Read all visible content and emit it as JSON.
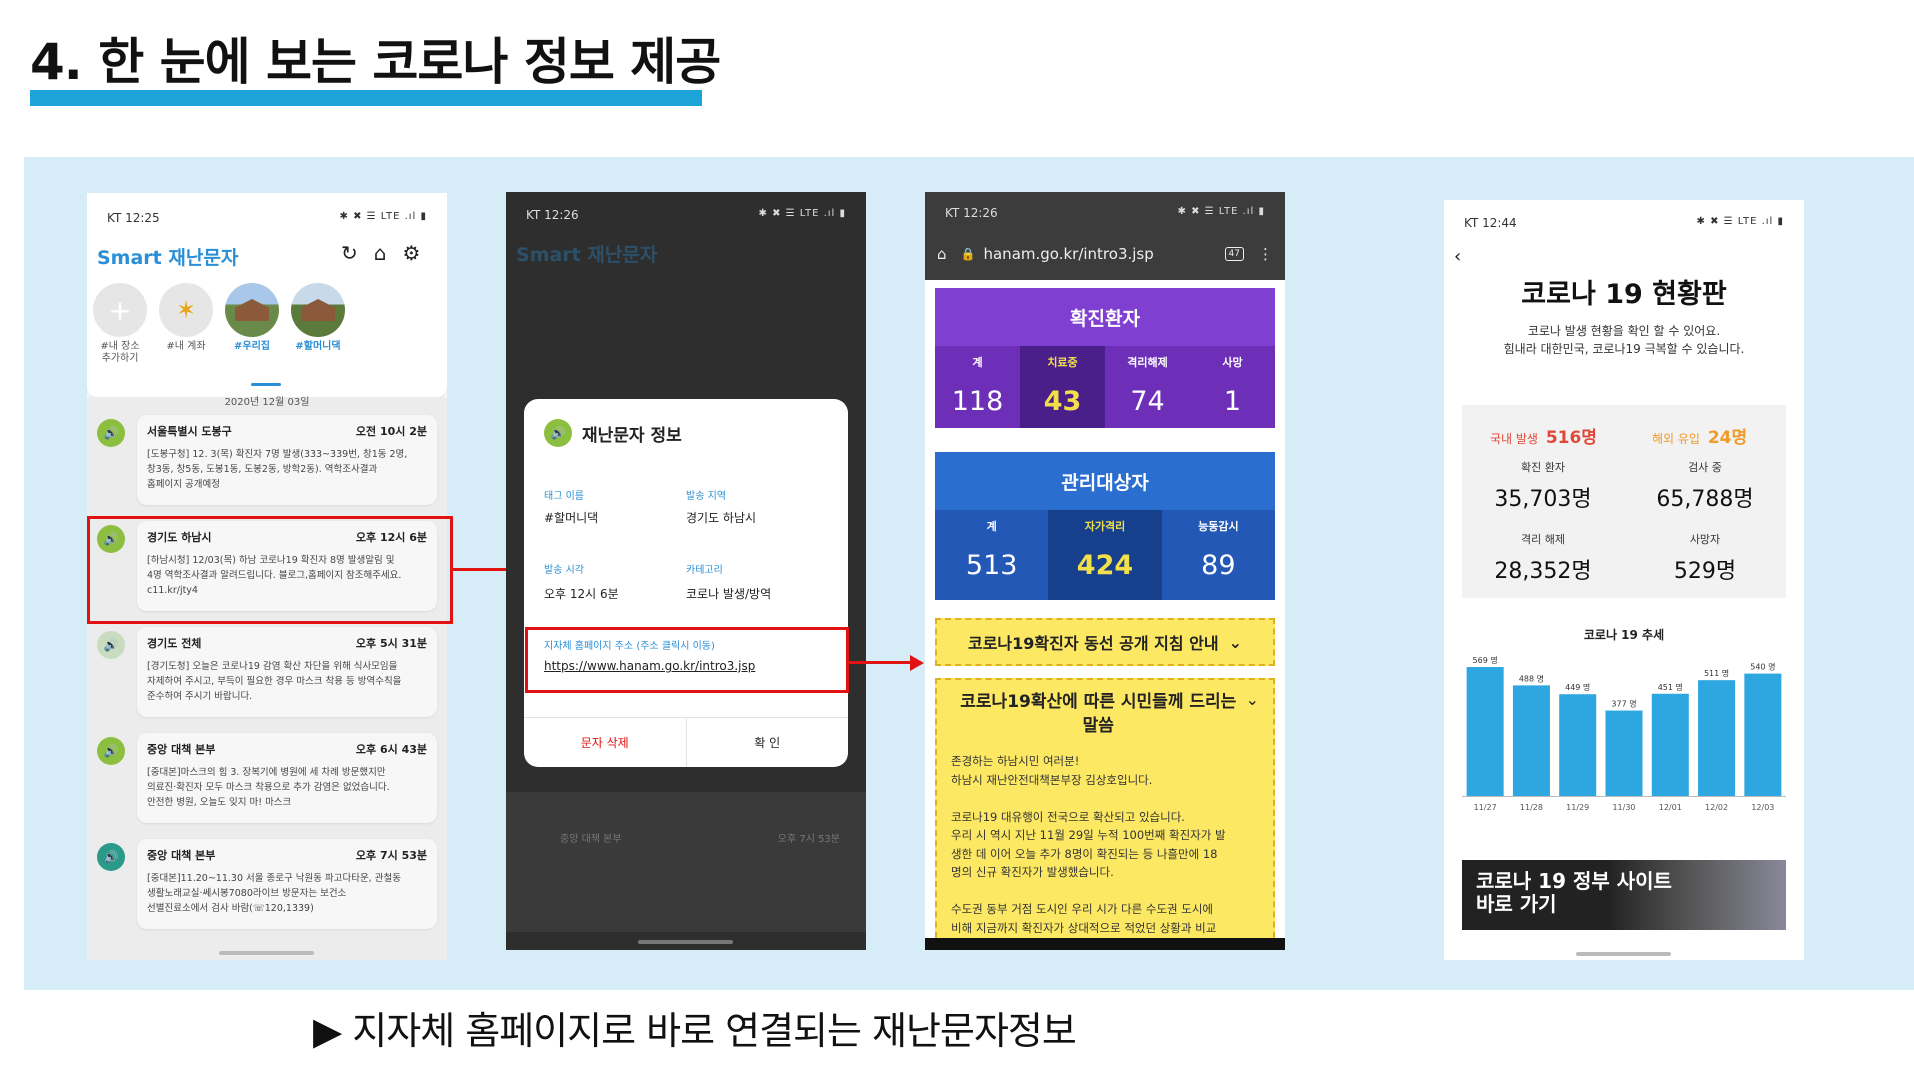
{
  "header": {
    "title": "4. 한 눈에 보는 코로나 정보 제공",
    "accent_color": "#1ca3d8"
  },
  "caption": "▶ 지자체 홈페이지로 바로 연결되는 재난문자정보",
  "phone1": {
    "status_time": "KT 12:25",
    "status_icons": "✱ ✖ ☰ LTE .ıl ▮",
    "app_title_prefix": "Smart",
    "app_title": "재난문자",
    "locations": [
      {
        "label": "#내 장소\n추가하기"
      },
      {
        "label": "#내 계좌"
      },
      {
        "label": "#우리집"
      },
      {
        "label": "#할머니댁"
      }
    ],
    "date_divider": "2020년 12월 03일",
    "messages": [
      {
        "sender": "서울특별시 도봉구",
        "time": "오전 10시 2분",
        "body": "[도봉구청] 12. 3(목) 확진자 7명 발생(333~339번, 창1동 2명,\n창3동, 창5동, 도봉1동, 도봉2동, 방학2동). 역학조사결과\n홈페이지 공개예정"
      },
      {
        "sender": "경기도 하남시",
        "time": "오후 12시 6분",
        "body": "[하남시청] 12/03(목) 하남 코로나19 확진자 8명 발생알림 및\n4명 역학조사결과 알려드립니다. 블로그,홈페이지 참조해주세요.\nc11.kr/jty4"
      },
      {
        "sender": "경기도 전체",
        "time": "오후 5시 31분",
        "body": "[경기도청] 오늘은 코로나19 감염 확산 차단을 위해 식사모임을\n자제하여 주시고, 부득이 필요한 경우 마스크 착용 등 방역수칙을\n준수하여 주시기 바랍니다."
      },
      {
        "sender": "중앙 대책 본부",
        "time": "오후 6시 43분",
        "body": "[중대본]마스크의 힘 3. 장복기에 병원에 세 차례 방문했지만\n의료진·확진자 모두 마스크 착용으로 추가 감염은 없었습니다.\n안전한 병원, 오늘도 잊지 마! 마스크"
      },
      {
        "sender": "중앙 대책 본부",
        "time": "오후 7시 53분",
        "body": "[중대본]11.20~11.30 서울 종로구 낙원동 파고다타운, 관철동\n생활노래교실·쎄시봉7080라이브 방문자는 보건소\n선별진료소에서 검사 바람(☏120,1339)"
      }
    ]
  },
  "phone2": {
    "status_time": "KT 12:26",
    "status_icons": "✱ ✖ ☰ LTE .ıl ▮",
    "dialog_title": "재난문자 정보",
    "tag_label": "태그 이름",
    "tag_value": "#할머니댁",
    "region_label": "발송 지역",
    "region_value": "경기도 하남시",
    "time_label": "발송 시각",
    "time_value": "오후 12시 6분",
    "category_label": "카테고리",
    "category_value": "코로나 발생/방역",
    "homepage_label": "지자체 홈페이지 주소 (주소 클릭시 이동)",
    "homepage_url": "https://www.hanam.go.kr/intro3.jsp",
    "delete_label": "문자 삭제",
    "confirm_label": "확  인",
    "bg_time": "오후 7시 53분"
  },
  "phone3": {
    "status_time": "KT 12:26",
    "status_icons": "✱ ✖ ☰ LTE .ıl ▮",
    "url": "hanam.go.kr/intro3.jsp",
    "tab_count": "47",
    "confirmed": {
      "title": "확진환자",
      "cols": [
        {
          "k": "계",
          "v": "118"
        },
        {
          "k": "치료중",
          "v": "43"
        },
        {
          "k": "격리해제",
          "v": "74"
        },
        {
          "k": "사망",
          "v": "1"
        }
      ]
    },
    "managed": {
      "title": "관리대상자",
      "cols": [
        {
          "k": "계",
          "v": "513"
        },
        {
          "k": "자가격리",
          "v": "424"
        },
        {
          "k": "능동감시",
          "v": "89"
        }
      ]
    },
    "notice1": "코로나19확진자 동선 공개 지침 안내",
    "notice2_title": "코로나19확산에 따른 시민들께 드리는 말씀",
    "notice2_body": "존경하는 하남시민 여러분!\n하남시 재난안전대책본부장 김상호입니다.\n\n코로나19 대유행이 전국으로 확산되고 있습니다.\n우리 시 역시 지난 11월 29일 누적 100번째 확진자가 발\n생한 데 이어 오늘 추가 8명이 확진되는 등 나흘만에 18\n명의 신규 확진자가 발생했습니다.\n\n수도권 동부 거점 도시인 우리 시가 다른 수도권 도시에\n비해 지금까지 확진자가 상대적으로 적었던 상황과 비교"
  },
  "phone4": {
    "status_time": "KT 12:44",
    "status_icons": "✱ ✖ ☰ LTE .ıl ▮",
    "title": "코로나 19 현황판",
    "subtitle1": "코로나 발생 현황을 확인 할 수 있어요.",
    "subtitle2": "힘내라 대한민국, 코로나19 극복할 수 있습니다.",
    "domestic_label": "국내 발생",
    "domestic_value": "516명",
    "overseas_label": "해외 유입",
    "overseas_value": "24명",
    "stats": [
      {
        "k": "확진 환자",
        "v": "35,703명"
      },
      {
        "k": "검사 중",
        "v": "65,788명"
      },
      {
        "k": "격리 해제",
        "v": "28,352명"
      },
      {
        "k": "사망자",
        "v": "529명"
      }
    ],
    "chart_title": "코로나 19 추세",
    "banner": "코로나 19 정부 사이트\n바로 가기"
  },
  "chart_data": {
    "type": "bar",
    "title": "코로나 19 추세",
    "categories": [
      "11/27",
      "11/28",
      "11/29",
      "11/30",
      "12/01",
      "12/02",
      "12/03"
    ],
    "values": [
      569,
      488,
      449,
      377,
      451,
      511,
      540
    ],
    "value_labels": [
      "569 명",
      "488 명",
      "449 명",
      "377 명",
      "451 명",
      "511 명",
      "540 명"
    ],
    "ylim": [
      0,
      600
    ],
    "color": "#2ea6e0"
  }
}
